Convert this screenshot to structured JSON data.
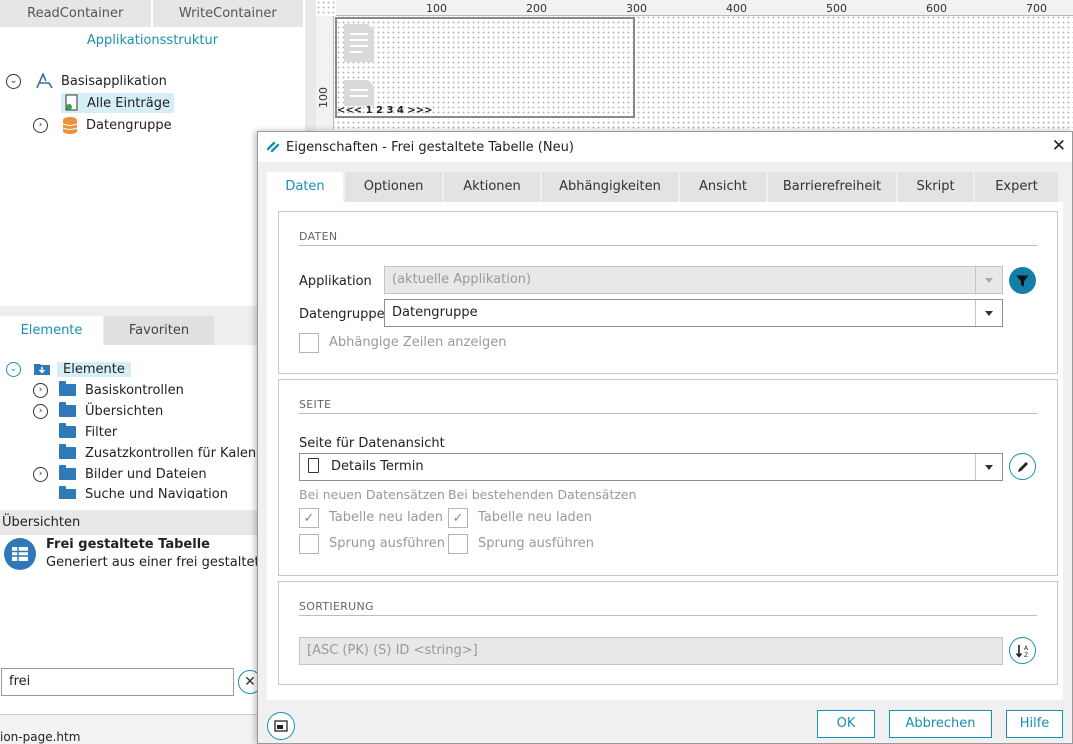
{
  "top_tabs": [
    "ReadContainer",
    "WriteContainer"
  ],
  "app_structure": {
    "title": "Applikationsstruktur",
    "items": [
      "Basisapplikation",
      "Alle Einträge",
      "Datengruppe"
    ]
  },
  "palette": {
    "tabs": [
      "Elemente",
      "Favoriten"
    ],
    "root": "Elemente",
    "items": [
      "Basiskontrollen",
      "Übersichten",
      "Filter",
      "Zusatzkontrollen für Kalende",
      "Bilder und Dateien",
      "Suche und Navigation"
    ]
  },
  "overview": {
    "section": "Übersichten",
    "title": "Frei gestaltete Tabelle",
    "description": "Generiert aus einer frei gestalteten A"
  },
  "search": {
    "value": "frei"
  },
  "bottom_text": "ion-page.htm",
  "ruler": {
    "h": [
      "100",
      "200",
      "300",
      "400",
      "500",
      "600",
      "700"
    ],
    "v": "100"
  },
  "canvas": {
    "pager": "<<< 1 2 3 4 >>>"
  },
  "dialog": {
    "title": "Eigenschaften - Frei gestaltete Tabelle (Neu)",
    "tabs": [
      "Daten",
      "Optionen",
      "Aktionen",
      "Abhängigkeiten",
      "Ansicht",
      "Barrierefreiheit",
      "Skript",
      "Expert"
    ],
    "daten": {
      "heading": "DATEN",
      "applikation_label": "Applikation",
      "applikation_value": "(aktuelle Applikation)",
      "datengruppe_label": "Datengruppe",
      "datengruppe_value": "Datengruppe",
      "abhaengige_label": "Abhängige Zeilen anzeigen"
    },
    "seite": {
      "heading": "SEITE",
      "label": "Seite für Datenansicht",
      "value": "Details Termin",
      "col1": "Bei neuen Datensätzen",
      "col2": "Bei bestehenden Datensätzen",
      "reload": "Tabelle neu laden",
      "jump": "Sprung ausführen"
    },
    "sortierung": {
      "heading": "SORTIERUNG",
      "value": "[ASC (PK) (S) ID <string>]"
    },
    "buttons": {
      "ok": "OK",
      "cancel": "Abbrechen",
      "help": "Hilfe"
    }
  },
  "colors": {
    "accent": "#1a8fb5",
    "folder": "#2f79b8"
  }
}
